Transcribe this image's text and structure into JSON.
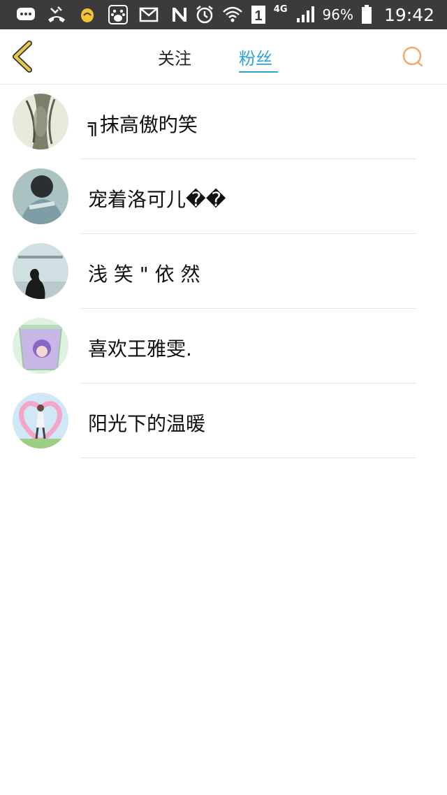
{
  "status_bar": {
    "network": "4G",
    "sim": "1",
    "battery": "96%",
    "time": "19:42",
    "icons": [
      "message-icon",
      "missed-call-icon",
      "notification-icon",
      "baidu-icon",
      "email-icon",
      "n-icon",
      "alarm-icon",
      "wifi-icon",
      "sim-icon",
      "signal-icon",
      "battery-icon"
    ]
  },
  "header": {
    "tabs": [
      {
        "label": "关注"
      },
      {
        "label": "粉丝"
      }
    ],
    "active_tab": "粉丝",
    "accent_color": "#2ea3d6",
    "back_color": "#e6c84a",
    "search_color": "#f3a76c"
  },
  "fans": [
    {
      "name": "╗抹高傲旳笑"
    },
    {
      "name": "宠着洛可儿��"
    },
    {
      "name": "浅 笑 \" 依 然"
    },
    {
      "name": "喜欢王雅雯."
    },
    {
      "name": "阳光下的温暖"
    }
  ]
}
